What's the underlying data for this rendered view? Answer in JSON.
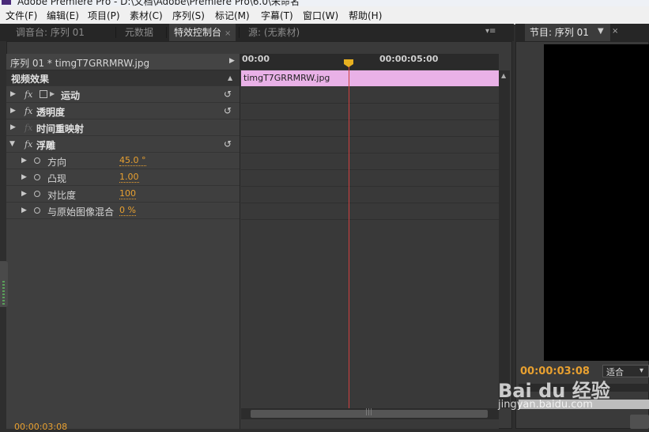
{
  "window": {
    "title": "Adobe Premiere Pro - D:\\文档\\Adobe\\Premiere Pro\\6.0\\未命名"
  },
  "menu": [
    "文件(F)",
    "编辑(E)",
    "项目(P)",
    "素材(C)",
    "序列(S)",
    "标记(M)",
    "字幕(T)",
    "窗口(W)",
    "帮助(H)"
  ],
  "tabs": [
    {
      "label": "调音台: 序列 01",
      "close": ""
    },
    {
      "label": "元数据",
      "close": ""
    },
    {
      "label": "特效控制台",
      "close": "×"
    },
    {
      "label": "源: (无素材)",
      "close": ""
    }
  ],
  "panel_menu_icon": "▾≡",
  "effect_controls": {
    "source_clip": "序列 01 * timgT7GRRMRW.jpg",
    "section": "视频效果",
    "effects": [
      {
        "label": "运动",
        "fx": "fx",
        "reset": "↺"
      },
      {
        "label": "透明度",
        "fx": "fx",
        "reset": "↺"
      },
      {
        "label": "时间重映射",
        "fx": "fx",
        "reset": ""
      },
      {
        "label": "浮雕",
        "fx": "fx",
        "reset": "↺"
      }
    ],
    "params": [
      {
        "label": "方向",
        "value": "45.0 °"
      },
      {
        "label": "凸现",
        "value": "1.00"
      },
      {
        "label": "对比度",
        "value": "100"
      },
      {
        "label": "与原始图像混合",
        "value": "0 %"
      }
    ]
  },
  "timeline": {
    "ticks": [
      "00:00",
      "00:00:05:00"
    ],
    "clip_name": "timgT7GRRMRW.jpg",
    "scroll_grip": "|||"
  },
  "status": {
    "timecode": "00:00:03:08"
  },
  "program": {
    "tab_label": "节目: 序列 01",
    "timecode": "00:00:03:08",
    "fit_label": "适合",
    "fit_arrow": "▾"
  },
  "watermark": {
    "logo": "Bai du 经验",
    "url": "jingyan.baidu.com"
  },
  "colors": {
    "clip": "#e9b1e7",
    "playhead": "#d04040",
    "timecode": "#e8a030",
    "value": "#e8a030"
  }
}
